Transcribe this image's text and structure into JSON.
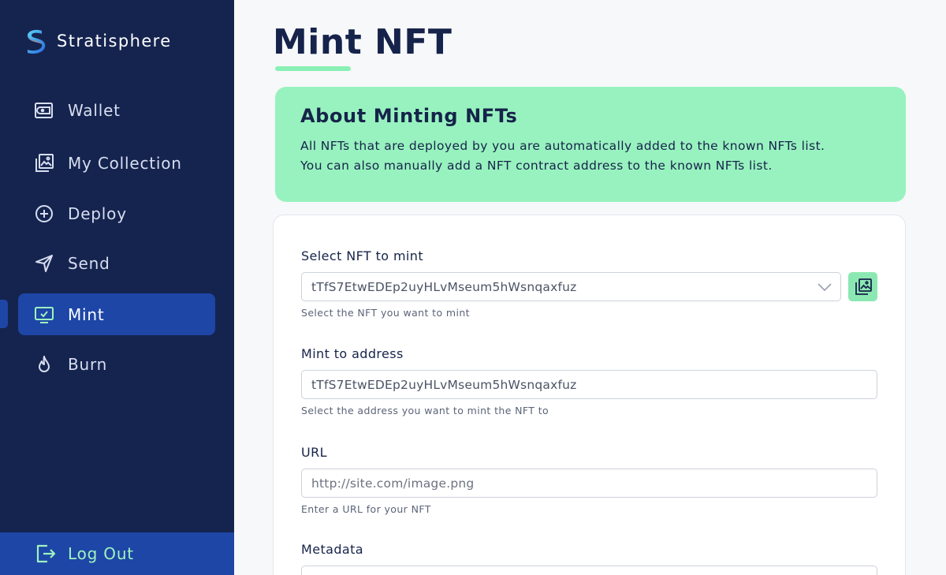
{
  "brand": {
    "name": "Stratisphere",
    "logo_icon": "stratisphere-logo"
  },
  "nav": {
    "items": [
      {
        "label": "Wallet",
        "icon": "wallet-icon"
      },
      {
        "label": "My Collection",
        "icon": "gallery-icon"
      },
      {
        "label": "Deploy",
        "icon": "plus-circle-icon"
      },
      {
        "label": "Send",
        "icon": "send-icon"
      },
      {
        "label": "Mint",
        "icon": "monitor-check-icon",
        "active": true
      },
      {
        "label": "Burn",
        "icon": "flame-icon"
      }
    ],
    "logout_label": "Log Out"
  },
  "page": {
    "title": "Mint NFT"
  },
  "info": {
    "title": "About Minting NFTs",
    "line1": "All NFTs that are deployed by you are automatically added to the known NFTs list.",
    "line2": "You can also manually add a NFT contract address to the known NFTs list."
  },
  "form": {
    "select_nft": {
      "label": "Select NFT to mint",
      "value": "tTfS7EtwEDEp2uyHLvMseum5hWsnqaxfuz",
      "help": "Select the NFT you want to mint"
    },
    "mint_to": {
      "label": "Mint to address",
      "value": "tTfS7EtwEDEp2uyHLvMseum5hWsnqaxfuz",
      "help": "Select the address you want to mint the NFT to"
    },
    "url": {
      "label": "URL",
      "placeholder": "http://site.com/image.png",
      "help": "Enter a URL for your NFT"
    },
    "metadata": {
      "label": "Metadata"
    }
  },
  "colors": {
    "sidebar_bg": "#15244f",
    "active_bg": "#1e46a6",
    "accent_green": "#98f2bf",
    "text_dark": "#16234a"
  }
}
